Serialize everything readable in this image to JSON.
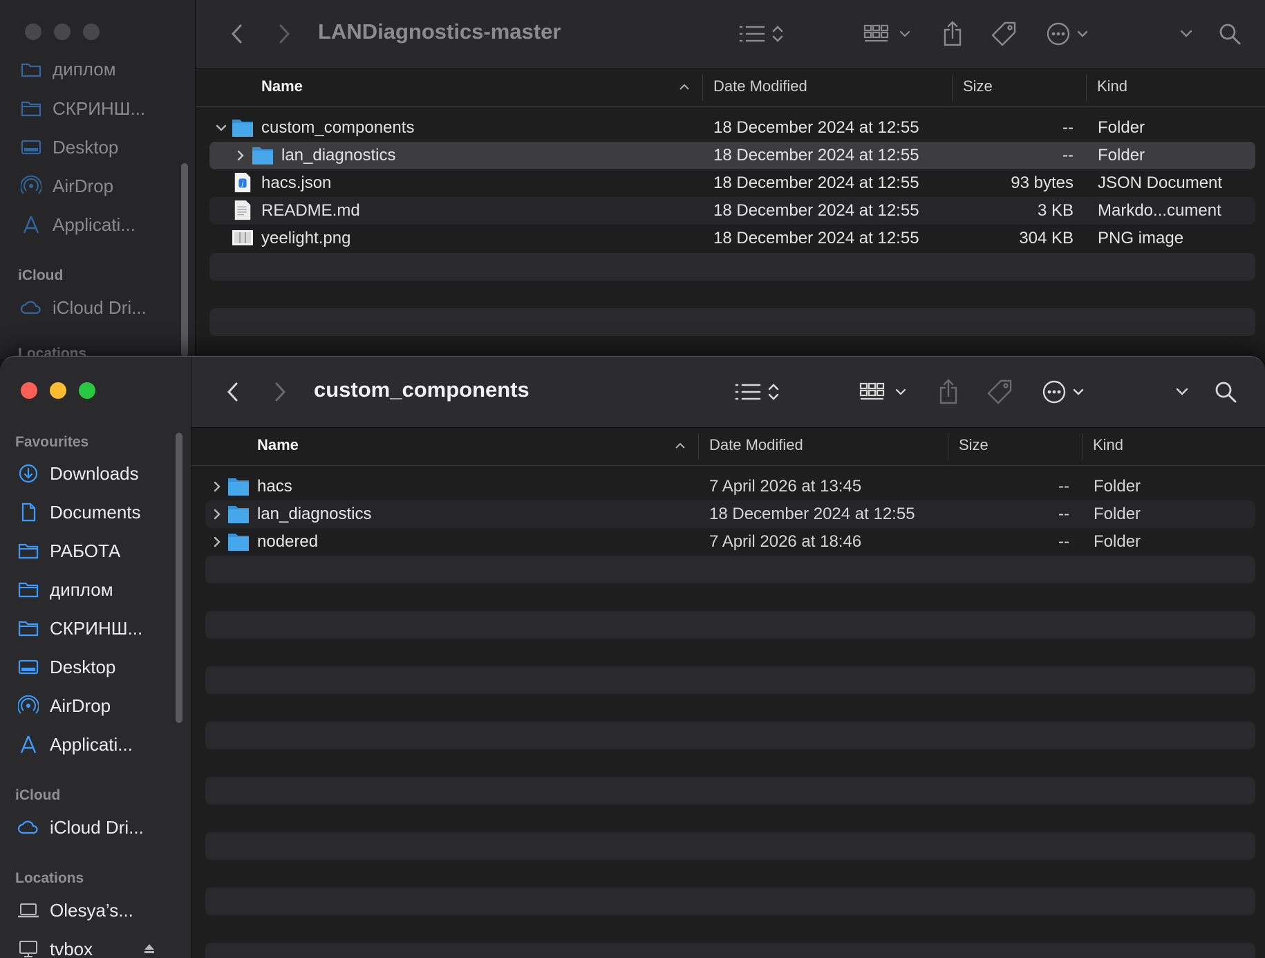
{
  "back_window": {
    "title": "LANDiagnostics-master",
    "sidebar": {
      "items": [
        {
          "label": "диплом",
          "icon": "folder-icon"
        },
        {
          "label": "СКРИНШ...",
          "icon": "folder-icon"
        },
        {
          "label": "Desktop",
          "icon": "desktop-icon"
        },
        {
          "label": "AirDrop",
          "icon": "airdrop-icon"
        },
        {
          "label": "Applicati...",
          "icon": "applications-icon"
        }
      ],
      "icloud_header": "iCloud",
      "icloud_item": "iCloud Dri...",
      "locations_header": "Locations"
    },
    "columns": {
      "name": "Name",
      "date": "Date Modified",
      "size": "Size",
      "kind": "Kind"
    },
    "rows": [
      {
        "name": "custom_components",
        "date": "18 December 2024 at 12:55",
        "size": "--",
        "kind": "Folder",
        "icon": "folder-icon",
        "expanded": true
      },
      {
        "name": "lan_diagnostics",
        "date": "18 December 2024 at 12:55",
        "size": "--",
        "kind": "Folder",
        "icon": "folder-icon",
        "expanded": false
      },
      {
        "name": "hacs.json",
        "date": "18 December 2024 at 12:55",
        "size": "93 bytes",
        "kind": "JSON Document",
        "icon": "json-file-icon"
      },
      {
        "name": "README.md",
        "date": "18 December 2024 at 12:55",
        "size": "3 KB",
        "kind": "Markdo...cument",
        "icon": "markdown-file-icon"
      },
      {
        "name": "yeelight.png",
        "date": "18 December 2024 at 12:55",
        "size": "304 KB",
        "kind": "PNG image",
        "icon": "image-file-icon"
      }
    ]
  },
  "front_window": {
    "title": "custom_components",
    "sidebar": {
      "favourites_header": "Favourites",
      "items": [
        {
          "label": "Downloads",
          "icon": "downloads-icon"
        },
        {
          "label": "Documents",
          "icon": "documents-icon"
        },
        {
          "label": "РАБОТА",
          "icon": "folder-icon"
        },
        {
          "label": "диплом",
          "icon": "folder-icon"
        },
        {
          "label": "СКРИНШ...",
          "icon": "folder-icon"
        },
        {
          "label": "Desktop",
          "icon": "desktop-icon"
        },
        {
          "label": "AirDrop",
          "icon": "airdrop-icon"
        },
        {
          "label": "Applicati...",
          "icon": "applications-icon"
        }
      ],
      "icloud_header": "iCloud",
      "icloud_item": "iCloud Dri...",
      "locations_header": "Locations",
      "locations": [
        {
          "label": "Olesya’s...",
          "icon": "laptop-icon"
        },
        {
          "label": "tvbox",
          "icon": "display-icon"
        }
      ]
    },
    "columns": {
      "name": "Name",
      "date": "Date Modified",
      "size": "Size",
      "kind": "Kind"
    },
    "rows": [
      {
        "name": "hacs",
        "date": "7 April 2026 at 13:45",
        "size": "--",
        "kind": "Folder",
        "icon": "folder-icon"
      },
      {
        "name": "lan_diagnostics",
        "date": "18 December 2024 at 12:55",
        "size": "--",
        "kind": "Folder",
        "icon": "folder-icon"
      },
      {
        "name": "nodered",
        "date": "7 April 2026 at 18:46",
        "size": "--",
        "kind": "Folder",
        "icon": "folder-icon"
      }
    ]
  },
  "colors": {
    "accent": "#3a9cff",
    "folder": "#46a7ea",
    "red": "#ff5f57",
    "yellow": "#febc2e",
    "green": "#28c840"
  }
}
